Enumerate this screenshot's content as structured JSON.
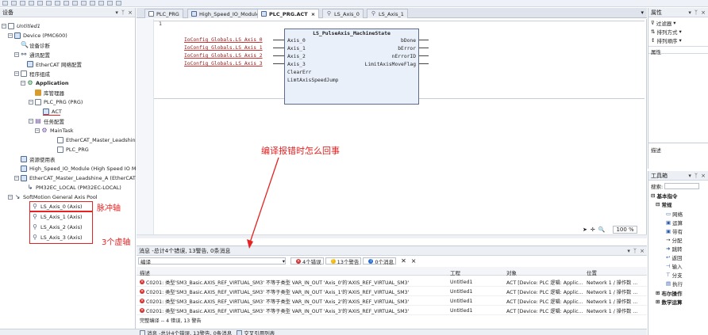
{
  "device_pane": {
    "title": "设备",
    "pin": "▾",
    "pin2": "ᛉ",
    "close": "×",
    "tree": [
      {
        "label": "Untitled1",
        "italic": true
      },
      {
        "label": "Device (PMC600)"
      },
      {
        "label": "设备诊断"
      },
      {
        "label": "通讯配置"
      },
      {
        "label": "EtherCAT 网络配置"
      },
      {
        "label": "程序组成"
      },
      {
        "label": "Application",
        "bold": true
      },
      {
        "label": "库管理器"
      },
      {
        "label": "PLC_PRG (PRG)"
      },
      {
        "label": "ACT"
      },
      {
        "label": "任务配置"
      },
      {
        "label": "MainTask"
      },
      {
        "label": "EtherCAT_Master_Leadshin"
      },
      {
        "label": "PLC_PRG"
      },
      {
        "label": "资源使用表"
      },
      {
        "label": "High_Speed_IO_Module (High Speed IO Mo"
      },
      {
        "label": "EtherCAT_Master_Leadshine_A (EtherCAT I"
      },
      {
        "label": "PM32EC_LOCAL (PM32EC-LOCAL)"
      },
      {
        "label": "SoftMotion General Axis Pool"
      },
      {
        "label": "LS_Axis_0 (Axis)"
      },
      {
        "label": "LS_Axis_1 (Axis)"
      },
      {
        "label": "LS_Axis_2 (Axis)"
      },
      {
        "label": "LS_Axis_3 (Axis)"
      }
    ],
    "annot_pulse": "脉冲轴",
    "annot_virtual": "3个虚轴"
  },
  "tabs": [
    {
      "label": "PLC_PRG"
    },
    {
      "label": "High_Speed_IO_Module"
    },
    {
      "label": "PLC_PRG.ACT",
      "close": "×"
    },
    {
      "label": "LS_Axis_0"
    },
    {
      "label": "LS_Axis_1"
    }
  ],
  "editor": {
    "line_no": "1",
    "fb_title": "LS_PulseAxis_MachineState",
    "inputs_vars": [
      "IoConfig_Globals.LS_Axis_0",
      "IoConfig_Globals.LS_Axis_1",
      "IoConfig_Globals.LS_Axis_2",
      "IoConfig_Globals.LS_Axis_3"
    ],
    "fb_inputs": [
      "Axis_0",
      "Axis_1",
      "Axis_2",
      "Axis_3",
      "ClearErr",
      "LimtAxisSpeedJump"
    ],
    "fb_outputs": [
      "bDone",
      "bError",
      "nErrorID",
      "LimitAxisMoveFlag"
    ],
    "question": "编译报错时怎么回事",
    "zoom": "100 %"
  },
  "messages": {
    "title": "消息 -总计4个错误, 13警告, 0条消息",
    "filter": "编译",
    "badge_errors": "4个错误",
    "badge_warnings": "13个警告",
    "badge_msgs": "0个消息",
    "col_desc": "描述",
    "col_project": "工程",
    "col_object": "对象",
    "col_pos": "位置",
    "rows": [
      {
        "desc": "C0201: 类型'SM3_Basic.AXIS_REF_VIRTUAL_SM3' 不等于类型 VAR_IN_OUT 'Axis_0'的'AXIS_REF_VIRTUAL_SM3'",
        "project": "Untitled1",
        "object": "ACT [Device: PLC 逻辑: Applic...",
        "pos": "Network 1 / 操作数 ..."
      },
      {
        "desc": "C0201: 类型'SM3_Basic.AXIS_REF_VIRTUAL_SM3' 不等于类型 VAR_IN_OUT 'Axis_1'的'AXIS_REF_VIRTUAL_SM3'",
        "project": "Untitled1",
        "object": "ACT [Device: PLC 逻辑: Applic...",
        "pos": "Network 1 / 操作数 ..."
      },
      {
        "desc": "C0201: 类型'SM3_Basic.AXIS_REF_VIRTUAL_SM3' 不等于类型 VAR_IN_OUT 'Axis_2'的'AXIS_REF_VIRTUAL_SM3'",
        "project": "Untitled1",
        "object": "ACT [Device: PLC 逻辑: Applic...",
        "pos": "Network 1 / 操作数 ..."
      },
      {
        "desc": "C0201: 类型'SM3_Basic.AXIS_REF_VIRTUAL_SM3' 不等于类型 VAR_IN_OUT 'Axis_3'的'AXIS_REF_VIRTUAL_SM3'",
        "project": "Untitled1",
        "object": "ACT [Device: PLC 逻辑: Applic...",
        "pos": "Network 1 / 操作数 ..."
      }
    ],
    "summary": "完整编译 -- 4 错误, 13 警告",
    "status_bar_msg": "消息 -总计4个错误, 13警告, 0条消息",
    "status_bar_ref": "交叉引用列表"
  },
  "props": {
    "title": "属性",
    "filter": "过滤器",
    "sort_by": "排列方式",
    "sort_order": "排列顺序",
    "col_attr": "属性",
    "desc_title": "描述"
  },
  "toolbox": {
    "title": "工具箱",
    "search_label": "搜索:",
    "items": [
      "基本指令",
      "常规",
      "网络",
      "运算",
      "带有",
      "分配",
      "跳转",
      "返回",
      "输入",
      "分支",
      "执行",
      "布尔操作",
      "数学运算"
    ]
  }
}
